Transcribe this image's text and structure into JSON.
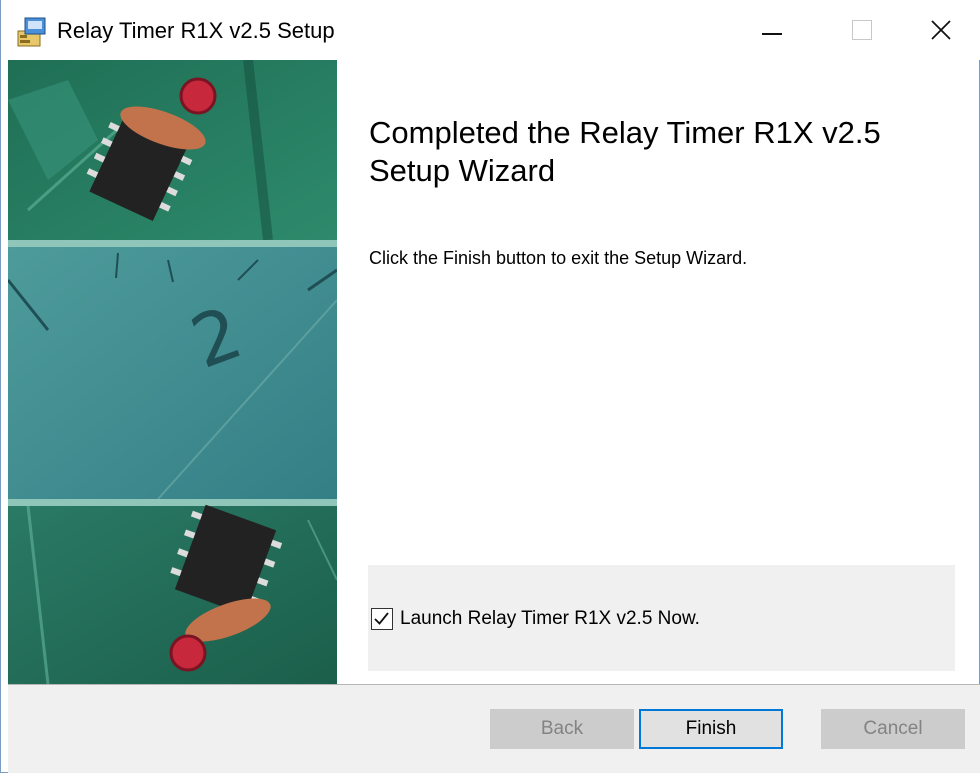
{
  "window": {
    "title": "Relay Timer R1X v2.5 Setup",
    "controls": {
      "minimize": "—",
      "close": "✕"
    }
  },
  "main": {
    "heading": "Completed the Relay Timer R1X v2.5 Setup Wizard",
    "description": "Click the Finish button to exit the Setup Wizard.",
    "launch_option": {
      "label": "Launch Relay Timer R1X v2.5 Now.",
      "checked": true,
      "check_glyph": "✓"
    }
  },
  "footer": {
    "back_label": "Back",
    "back_enabled": false,
    "finish_label": "Finish",
    "cancel_label": "Cancel",
    "cancel_enabled": false
  },
  "banner": {
    "dial_numeral": "2",
    "image_description_icons": [
      "circuit-board-image",
      "clock-dial-image"
    ]
  },
  "colors": {
    "accent": "#0078d7",
    "banner_teal": "#3d8f8f",
    "footer_bg": "#f0f0f0"
  }
}
